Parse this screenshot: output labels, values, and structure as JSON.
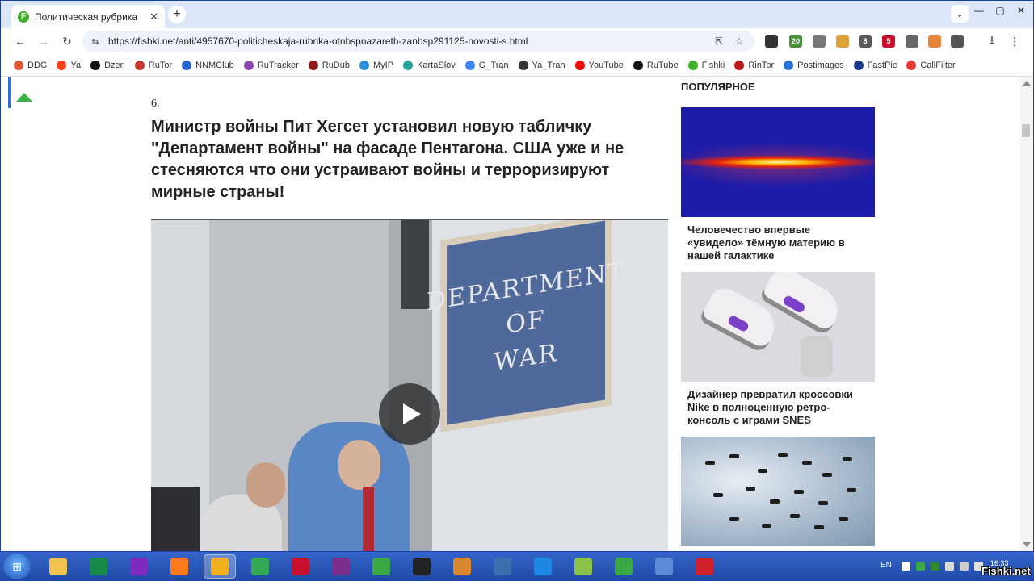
{
  "browser": {
    "tab_title": "Политическая рубрика от N",
    "tab_favicon": "F",
    "url": "https://fishki.net/anti/4957670-politicheskaja-rubrika-otnbspnazareth-zanbsp291125-novosti-s.html",
    "new_tab_symbol": "+",
    "window_controls": [
      "—",
      "▢",
      "✕"
    ],
    "nav_glyphs": {
      "back": "←",
      "forward": "→",
      "reload": "↻",
      "site_info": "⇆",
      "install": "⇱",
      "star": "☆",
      "download": "⭳",
      "menu": "⋮"
    },
    "extension_badges": [
      "20",
      "8",
      "5"
    ]
  },
  "bookmarks": [
    {
      "label": "DDG",
      "color": "#de5833"
    },
    {
      "label": "Ya",
      "color": "#fc3f1d"
    },
    {
      "label": "Dzen",
      "color": "#111111"
    },
    {
      "label": "RuTor",
      "color": "#c0392b"
    },
    {
      "label": "NNMClub",
      "color": "#2266cc"
    },
    {
      "label": "RuTracker",
      "color": "#8e44ad"
    },
    {
      "label": "RuDub",
      "color": "#8b1a1a"
    },
    {
      "label": "MyIP",
      "color": "#2a8fd6"
    },
    {
      "label": "KartaSlov",
      "color": "#2aa198"
    },
    {
      "label": "G_Tran",
      "color": "#4285f4"
    },
    {
      "label": "Ya_Tran",
      "color": "#333333"
    },
    {
      "label": "YouTube",
      "color": "#ff0000"
    },
    {
      "label": "RuTube",
      "color": "#101010"
    },
    {
      "label": "Fishki",
      "color": "#3fae2a"
    },
    {
      "label": "RinTor",
      "color": "#c01818"
    },
    {
      "label": "Postimages",
      "color": "#2b6fd8"
    },
    {
      "label": "FastPic",
      "color": "#1e3a8a"
    },
    {
      "label": "CallFilter",
      "color": "#e53935"
    }
  ],
  "article": {
    "item_number": "6.",
    "headline": "Министр войны Пит Хегсет установил новую табличку \"Департамент войны\" на фасаде Пентагона. США уже и не стесняются что они устраивают войны и терроризируют мирные страны!",
    "video": {
      "plaque_lines": [
        "DEPARTMENT",
        "OF",
        "WAR"
      ]
    }
  },
  "sidebar": {
    "title": "ПОПУЛЯРНОЕ",
    "cards": [
      {
        "caption": "Человечество впервые «увидело» тёмную материю в нашей галактике"
      },
      {
        "caption": "Дизайнер превратил кроссовки Nike в полноценную ретро-консоль с играми SNES"
      },
      {
        "caption": ""
      }
    ]
  },
  "taskbar": {
    "language": "EN",
    "clock": "16:33",
    "apps": [
      {
        "name": "explorer",
        "color": "#f2c14e"
      },
      {
        "name": "app-circle",
        "color": "#1a8a4a"
      },
      {
        "name": "audio",
        "color": "#7b2cbf"
      },
      {
        "name": "firefox",
        "color": "#ff7a1a"
      },
      {
        "name": "app-active",
        "color": "#f2b01e"
      },
      {
        "name": "chrome",
        "color": "#34a853"
      },
      {
        "name": "filezilla",
        "color": "#c8102e"
      },
      {
        "name": "winrar",
        "color": "#7a2f8f"
      },
      {
        "name": "puzzle",
        "color": "#3aa845"
      },
      {
        "name": "ninja",
        "color": "#222222"
      },
      {
        "name": "box",
        "color": "#d9882b"
      },
      {
        "name": "network",
        "color": "#3a6fb0"
      },
      {
        "name": "vscode",
        "color": "#1e88e5"
      },
      {
        "name": "notepad",
        "color": "#8bc34a"
      },
      {
        "name": "utorrent",
        "color": "#3aa845"
      },
      {
        "name": "qbittorrent",
        "color": "#5b8ad8"
      },
      {
        "name": "app-p",
        "color": "#d1202a"
      }
    ]
  },
  "watermark": "Fishki.net"
}
